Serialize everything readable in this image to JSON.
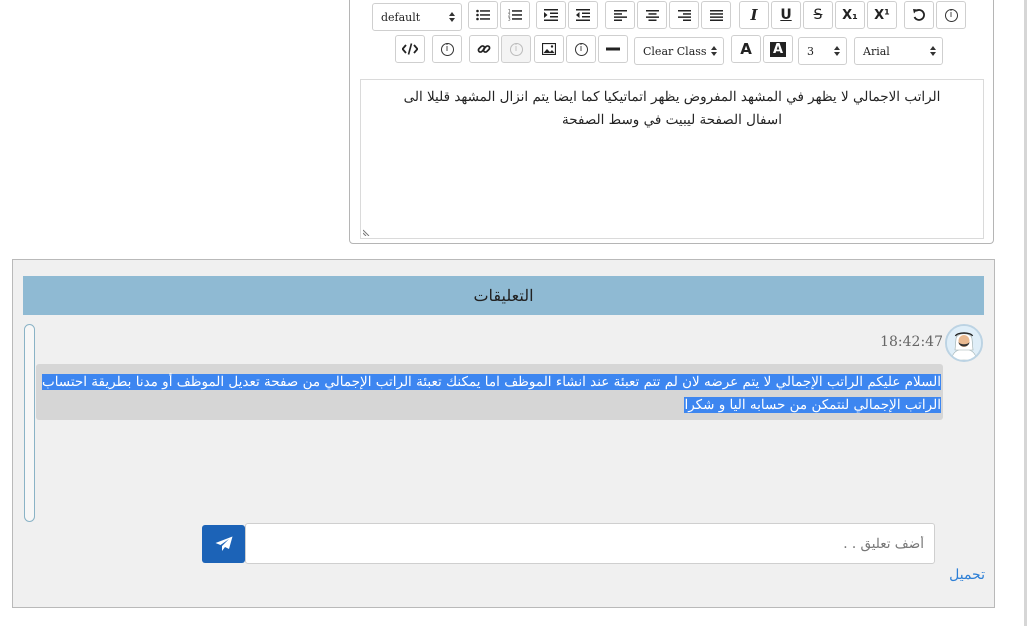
{
  "toolbar": {
    "style_select": "default",
    "clear_class": "Clear Class",
    "font_size": "3",
    "font_family": "Arial",
    "bold_icon_label": "A",
    "bg_color_icon_label": "A",
    "italic_label": "I",
    "underline_label": "U",
    "strike_label": "S",
    "subscript_label": "X₁",
    "superscript_label": "X¹",
    "info_label": "i"
  },
  "editor": {
    "content": "الراتب الاجمالي لا يظهر في المشهد المفروض يظهر اتماتيكيا  كما ايضا يتم انزال  المشهد قليلا الى اسفال الصفحة ليبيت في وسط الصفحة"
  },
  "comments": {
    "title": "التعليقات",
    "items": [
      {
        "time": "18:42:47",
        "text": "السلام عليكم الراتب الإجمالي لا يتم عرضه لان لم تتم تعبئة عند انشاء الموظف اما يمكنك تعبئة الراتب الإجمالي من صفحة تعديل الموظف أو مدنا بطريقة احتساب الراتب الإجمالي لنتمكن من حسابه اليا و شكرا"
      }
    ],
    "input_placeholder": "أضف تعليق . .",
    "upload_label": "تحميل"
  },
  "colors": {
    "comments_header_bg": "#8fbad3",
    "send_button_bg": "#1c63b7",
    "selection_bg": "#3d86f0",
    "upload_link": "#2d7fd6"
  },
  "icons": [
    "code-view-icon",
    "info-icon",
    "link-icon",
    "image-icon",
    "horizontal-rule-icon",
    "unordered-list-icon",
    "ordered-list-icon",
    "indent-icon",
    "outdent-icon",
    "align-left-icon",
    "align-center-icon",
    "align-right-icon",
    "align-justify-icon",
    "undo-icon",
    "send-icon",
    "avatar-icon"
  ]
}
